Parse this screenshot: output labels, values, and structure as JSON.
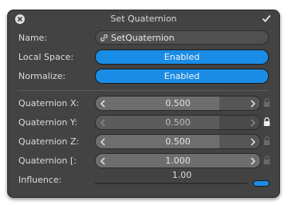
{
  "header": {
    "title": "Set Quaternion",
    "close_icon": "close-icon",
    "confirm_icon": "checkmark-icon"
  },
  "rows": {
    "name": {
      "label": "Name:",
      "value": "SetQuaternion",
      "icon": "link-icon"
    },
    "local_space": {
      "label": "Local Space:",
      "value": "Enabled"
    },
    "normalize": {
      "label": "Normalize:",
      "value": "Enabled"
    }
  },
  "quaternion": [
    {
      "label": "Quaternion X:",
      "value": "0.500",
      "fraction": 0.75,
      "locked": false
    },
    {
      "label": "Quaternion Y:",
      "value": "0.500",
      "fraction": 0.75,
      "locked": true
    },
    {
      "label": "Quaternion Z:",
      "value": "0.500",
      "fraction": 0.75,
      "locked": false
    },
    {
      "label": "Quaternion [:",
      "value": "1.000",
      "fraction": 1.0,
      "locked": false
    }
  ],
  "influence": {
    "label": "Influence:",
    "value": "1.00",
    "fraction": 1.0
  },
  "colors": {
    "accent": "#1a8ce6",
    "panel": "#434343"
  }
}
